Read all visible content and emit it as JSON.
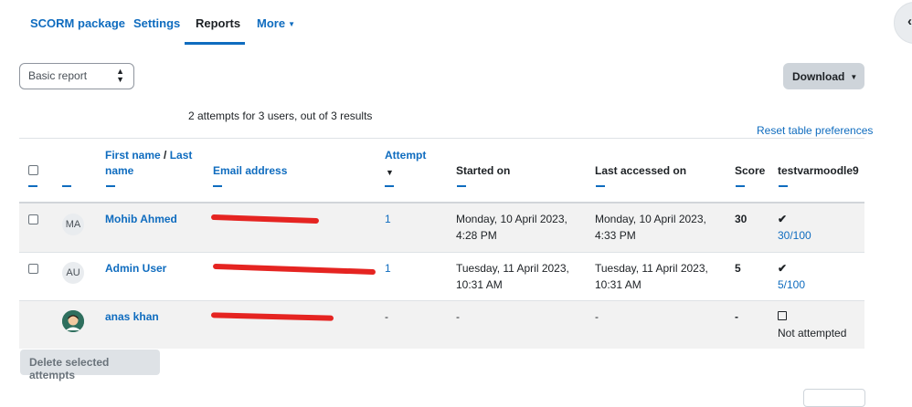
{
  "nav": {
    "tabs": [
      {
        "label": "SCORM package"
      },
      {
        "label": "Settings"
      },
      {
        "label": "Reports"
      },
      {
        "label": "More"
      }
    ]
  },
  "controls": {
    "report_type": "Basic report",
    "download_label": "Download",
    "summary": "2 attempts for 3 users, out of 3 results",
    "reset_label": "Reset table preferences"
  },
  "table": {
    "headers": {
      "first_name": "First name",
      "slash": "/",
      "last_name_1": "Last",
      "last_name_2": "name",
      "email": "Email address",
      "attempt": "Attempt",
      "started": "Started on",
      "last_accessed": "Last accessed on",
      "score": "Score",
      "sco": "testvarmoodle9"
    },
    "rows": [
      {
        "initials": "MA",
        "name": "Mohib Ahmed",
        "attempt": "1",
        "started_1": "Monday, 10 April 2023,",
        "started_2": "4:28 PM",
        "accessed_1": "Monday, 10 April 2023,",
        "accessed_2": "4:33 PM",
        "score": "30",
        "sco_mark": "✔",
        "sco_value": "30/100"
      },
      {
        "initials": "AU",
        "name": "Admin User",
        "attempt": "1",
        "started_1": "Tuesday, 11 April 2023,",
        "started_2": "10:31 AM",
        "accessed_1": "Tuesday, 11 April 2023,",
        "accessed_2": "10:31 AM",
        "score": "5",
        "sco_mark": "✔",
        "sco_value": "5/100"
      },
      {
        "initials": "",
        "name": "anas khan",
        "attempt": "-",
        "started_1": "-",
        "accessed_1": "-",
        "score": "-",
        "sco_value": "Not attempted"
      }
    ]
  },
  "footer": {
    "delete_label": "Delete selected attempts"
  }
}
